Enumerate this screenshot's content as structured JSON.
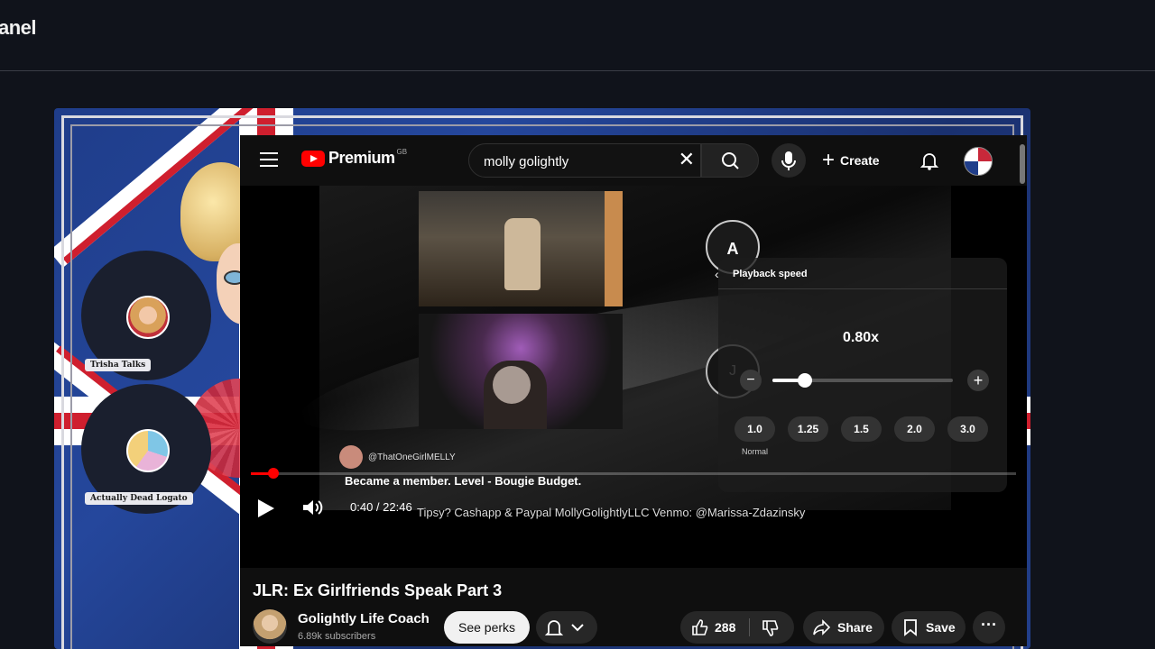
{
  "page": {
    "title": "anel"
  },
  "overlay": {
    "participants": [
      {
        "name": "Trisha Talks"
      },
      {
        "name": "Actually Dead Logato"
      }
    ]
  },
  "youtube": {
    "logo_text": "Premium",
    "region_code": "GB",
    "search": {
      "value": "molly golightly"
    },
    "create_label": "Create",
    "video": {
      "playback_menu": {
        "header": "Playback speed",
        "speed_value": "0.80x",
        "speed_fraction": 0.18,
        "presets": [
          "1.0",
          "1.25",
          "1.5",
          "2.0",
          "3.0"
        ],
        "normal_label": "Normal",
        "circle_a": "A",
        "circle_j": "J"
      },
      "chat": {
        "user": "@ThatOneGirlMELLY",
        "message": "Became a member. Level - Bougie Budget."
      },
      "banner_text": "Tipsy? Cashapp & Paypal MollyGolightlyLLC  Venmo: @Marissa-Zdazinsky",
      "time": "0:40 / 22:46",
      "progress_fraction": 0.03
    },
    "meta": {
      "title": "JLR: Ex Girlfriends Speak Part 3",
      "channel": "Golightly Life Coach",
      "subscribers": "6.89k subscribers",
      "perks_label": "See perks",
      "likes": "288",
      "share_label": "Share",
      "save_label": "Save"
    }
  }
}
